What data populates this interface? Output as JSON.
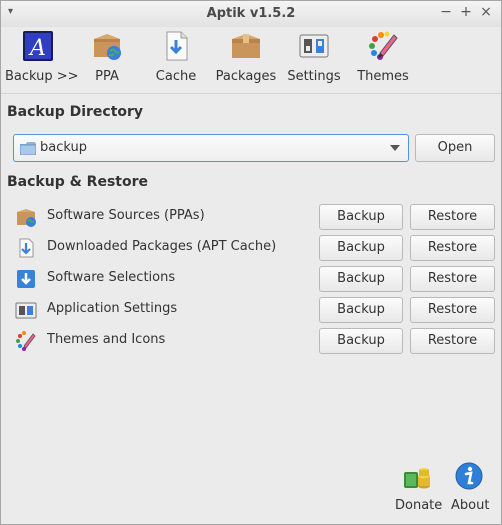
{
  "window": {
    "title": "Aptik v1.5.2",
    "menu_glyph": "▾",
    "minimize_glyph": "−",
    "maximize_glyph": "+",
    "close_glyph": "×"
  },
  "toolbar": {
    "items": [
      {
        "label": "Backup >>",
        "icon": "backup-icon"
      },
      {
        "label": "PPA",
        "icon": "ppa-package-globe-icon"
      },
      {
        "label": "Cache",
        "icon": "cache-download-icon"
      },
      {
        "label": "Packages",
        "icon": "packages-box-icon"
      },
      {
        "label": "Settings",
        "icon": "settings-icon"
      },
      {
        "label": "Themes",
        "icon": "themes-palette-icon"
      }
    ]
  },
  "backup_directory": {
    "heading": "Backup Directory",
    "path": "backup",
    "open_label": "Open"
  },
  "backup_restore": {
    "heading": "Backup & Restore",
    "rows": [
      {
        "label": "Software Sources (PPAs)",
        "backup": "Backup",
        "restore": "Restore",
        "icon": "ppa-package-globe-icon"
      },
      {
        "label": "Downloaded Packages (APT Cache)",
        "backup": "Backup",
        "restore": "Restore",
        "icon": "download-arrow-icon"
      },
      {
        "label": "Software Selections",
        "backup": "Backup",
        "restore": "Restore",
        "icon": "software-selection-icon"
      },
      {
        "label": "Application Settings",
        "backup": "Backup",
        "restore": "Restore",
        "icon": "settings-icon"
      },
      {
        "label": "Themes and Icons",
        "backup": "Backup",
        "restore": "Restore",
        "icon": "themes-palette-icon"
      }
    ]
  },
  "footer": {
    "donate_label": "Donate",
    "about_label": "About"
  },
  "colors": {
    "accent": "#5294e2",
    "background": "#ebebeb"
  }
}
